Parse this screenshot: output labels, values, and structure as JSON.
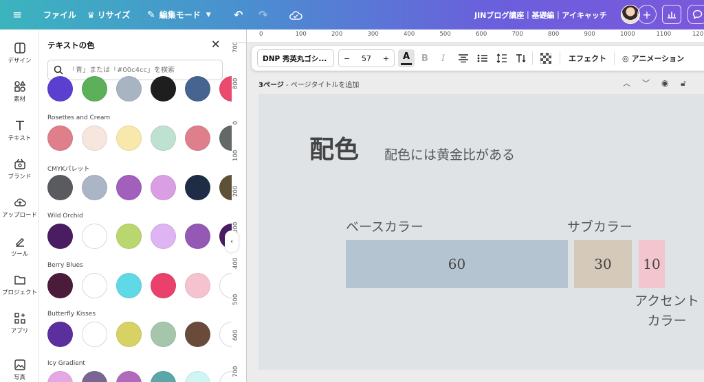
{
  "topbar": {
    "file": "ファイル",
    "resize": "リサイズ",
    "edit_mode": "編集モード",
    "doc_title": "JINブログ講座｜基礎編｜アイキャッチ"
  },
  "rail": {
    "items": [
      {
        "label": "デザイン",
        "icon": "design-icon"
      },
      {
        "label": "素材",
        "icon": "elements-icon"
      },
      {
        "label": "テキスト",
        "icon": "text-icon"
      },
      {
        "label": "ブランド",
        "icon": "brand-icon"
      },
      {
        "label": "アップロード",
        "icon": "upload-icon"
      },
      {
        "label": "ツール",
        "icon": "tools-icon"
      },
      {
        "label": "プロジェクト",
        "icon": "folder-icon"
      },
      {
        "label": "アプリ",
        "icon": "apps-icon"
      },
      {
        "label": "写真",
        "icon": "photo-icon"
      }
    ]
  },
  "panel": {
    "title": "テキストの色",
    "search_placeholder": "「青」または「#00c4cc」を検索",
    "top_row": [
      "#5b3fd1",
      "#5cb05a",
      "#a9b4c2",
      "#1e1e1e",
      "#46648f",
      "#ea4a6e"
    ],
    "palettes": [
      {
        "name": "Rosettes and Cream",
        "colors": [
          "#e07f8c",
          "#f6e6dd",
          "#f8e8ac",
          "#bfe1d2",
          "#e07f8c",
          "#626966"
        ]
      },
      {
        "name": "CMYKパレット",
        "colors": [
          "#5a5b5f",
          "#aab6c6",
          "#a25fbc",
          "#d99ee4",
          "#1e2d45",
          "#5f5138"
        ]
      },
      {
        "name": "Wild Orchid",
        "colors": [
          "#4a1c62",
          "#ffffff",
          "#b9d76e",
          "#deb4f2",
          "#9359b5",
          "#4a1c62"
        ]
      },
      {
        "name": "Berry Blues",
        "colors": [
          "#4a1c39",
          "#ffffff",
          "#5fd9e6",
          "#e9416b",
          "#f5c3d0",
          "#ffffff"
        ]
      },
      {
        "name": "Butterfly Kisses",
        "colors": [
          "#5b2f9e",
          "#ffffff",
          "#d8d164",
          "#a5c6ab",
          "#6a4b3b",
          "#ffffff"
        ]
      },
      {
        "name": "Icy Gradient",
        "colors": [
          "#e5a8e4",
          "#7a6692",
          "#b16abb",
          "#5aa6a8",
          "#cff6f5",
          "#ffffff"
        ]
      }
    ]
  },
  "ruler": {
    "h": [
      "0",
      "100",
      "200",
      "300",
      "400",
      "500",
      "600",
      "700",
      "800",
      "900",
      "1000",
      "1100",
      "120"
    ],
    "v": [
      "700",
      "800",
      "0",
      "100",
      "200",
      "300",
      "400",
      "500",
      "600",
      "700"
    ]
  },
  "toolbar": {
    "font": "DNP 秀英丸ゴシ...",
    "size": "57",
    "effect": "エフェクト",
    "animation": "アニメーション"
  },
  "page": {
    "number": "3ページ",
    "title_placeholder": "- ページタイトルを追加"
  },
  "slide": {
    "title": "配色",
    "subtitle": "配色には黄金比がある",
    "base_label": "ベースカラー",
    "sub_label": "サブカラー",
    "accent_label_1": "アクセント",
    "accent_label_2": "カラー",
    "base_value": "60",
    "sub_value": "30",
    "accent_value": "10",
    "colors": {
      "base": "#b4c5d1",
      "sub": "#d5cab9",
      "accent": "#f3c5cf",
      "background": "#dfe3e6"
    }
  }
}
